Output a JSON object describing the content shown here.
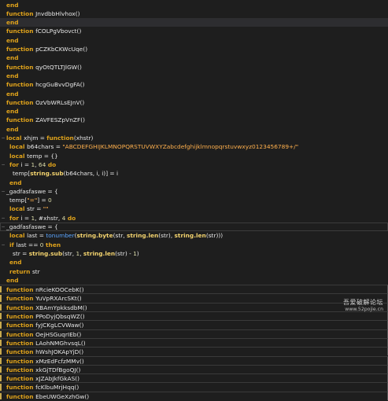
{
  "editor": {
    "lines": [
      {
        "tokens": [
          {
            "t": "end",
            "c": "kw"
          }
        ]
      },
      {
        "tokens": [
          {
            "t": "function ",
            "c": "kw"
          },
          {
            "t": "JnvdbbHlvhox()",
            "c": "id"
          }
        ]
      },
      {
        "tokens": [
          {
            "t": "end",
            "c": "kw"
          }
        ],
        "hl": true
      },
      {
        "tokens": [
          {
            "t": "function ",
            "c": "kw"
          },
          {
            "t": "fCOLPgVbovct()",
            "c": "id"
          }
        ]
      },
      {
        "tokens": [
          {
            "t": "end",
            "c": "kw"
          }
        ]
      },
      {
        "tokens": [
          {
            "t": "function ",
            "c": "kw"
          },
          {
            "t": "pCZKbCKWcUqe()",
            "c": "id"
          }
        ]
      },
      {
        "tokens": [
          {
            "t": "end",
            "c": "kw"
          }
        ]
      },
      {
        "tokens": [
          {
            "t": "function ",
            "c": "kw"
          },
          {
            "t": "qyOtQTLTJlGW()",
            "c": "id"
          }
        ]
      },
      {
        "tokens": [
          {
            "t": "end",
            "c": "kw"
          }
        ]
      },
      {
        "tokens": [
          {
            "t": "function ",
            "c": "kw"
          },
          {
            "t": "hcgGuBvvDgFA()",
            "c": "id"
          }
        ]
      },
      {
        "tokens": [
          {
            "t": "end",
            "c": "kw"
          }
        ]
      },
      {
        "tokens": [
          {
            "t": "function ",
            "c": "kw"
          },
          {
            "t": "OzVbWRLsEJnV()",
            "c": "id"
          }
        ]
      },
      {
        "tokens": [
          {
            "t": "end",
            "c": "kw"
          }
        ]
      },
      {
        "tokens": [
          {
            "t": "function ",
            "c": "kw"
          },
          {
            "t": "ZAVFESZpVnZF()",
            "c": "id"
          }
        ]
      },
      {
        "tokens": [
          {
            "t": "end",
            "c": "kw"
          }
        ]
      },
      {
        "tokens": [
          {
            "t": "local ",
            "c": "kw"
          },
          {
            "t": "xhjm = ",
            "c": "id"
          },
          {
            "t": "function",
            "c": "kw"
          },
          {
            "t": "(xhstr)",
            "c": "id"
          }
        ],
        "fold": "−"
      },
      {
        "tokens": [
          {
            "t": "local ",
            "c": "kw"
          },
          {
            "t": "b64chars = ",
            "c": "id"
          },
          {
            "t": "\"ABCDEFGHIJKLMNOPQRSTUVWXYZabcdefghijklmnopqrstuvwxyz0123456789+/\"",
            "c": "str"
          }
        ],
        "ind": 1
      },
      {
        "tokens": [
          {
            "t": "local ",
            "c": "kw"
          },
          {
            "t": "temp = {}",
            "c": "id"
          }
        ],
        "ind": 1
      },
      {
        "tokens": [
          {
            "t": "for ",
            "c": "kw"
          },
          {
            "t": "i = ",
            "c": "id"
          },
          {
            "t": "1",
            "c": "num"
          },
          {
            "t": ", ",
            "c": "id"
          },
          {
            "t": "64",
            "c": "num"
          },
          {
            "t": " do",
            "c": "kw"
          }
        ],
        "ind": 1,
        "fold": "−"
      },
      {
        "tokens": [
          {
            "t": "temp[",
            "c": "id"
          },
          {
            "t": "string.sub",
            "c": "bi"
          },
          {
            "t": "(b64chars, i, i)] = i",
            "c": "id"
          }
        ],
        "ind": 2
      },
      {
        "tokens": [
          {
            "t": "end",
            "c": "kw"
          }
        ],
        "ind": 1
      },
      {
        "tokens": [
          {
            "t": "_gadfasfaswe = {",
            "c": "id"
          }
        ],
        "fold": "−"
      },
      {
        "tokens": [
          {
            "t": "temp[",
            "c": "id"
          },
          {
            "t": "\"=\"",
            "c": "str"
          },
          {
            "t": "] = ",
            "c": "id"
          },
          {
            "t": "0",
            "c": "num"
          }
        ],
        "ind": 1
      },
      {
        "tokens": [
          {
            "t": "local ",
            "c": "kw"
          },
          {
            "t": "str = ",
            "c": "id"
          },
          {
            "t": "\"\"",
            "c": "str"
          }
        ],
        "ind": 1
      },
      {
        "tokens": [
          {
            "t": "for ",
            "c": "kw"
          },
          {
            "t": "i = ",
            "c": "id"
          },
          {
            "t": "1",
            "c": "num"
          },
          {
            "t": ", #xhstr, ",
            "c": "id"
          },
          {
            "t": "4",
            "c": "num"
          },
          {
            "t": " do",
            "c": "kw"
          }
        ],
        "ind": 1,
        "fold": "−"
      },
      {
        "tokens": [
          {
            "t": "_gadfasfaswe = {",
            "c": "id"
          }
        ],
        "fold": "−",
        "boxed": true
      },
      {
        "tokens": [
          {
            "t": "local ",
            "c": "kw"
          },
          {
            "t": "last = ",
            "c": "id"
          },
          {
            "t": "tonumber",
            "c": "fn-call"
          },
          {
            "t": "(",
            "c": "id"
          },
          {
            "t": "string.byte",
            "c": "bi"
          },
          {
            "t": "(str, ",
            "c": "id"
          },
          {
            "t": "string.len",
            "c": "bi"
          },
          {
            "t": "(str), ",
            "c": "id"
          },
          {
            "t": "string.len",
            "c": "bi"
          },
          {
            "t": "(str)))",
            "c": "id"
          }
        ],
        "ind": 1
      },
      {
        "tokens": [
          {
            "t": "if ",
            "c": "kw"
          },
          {
            "t": "last == ",
            "c": "id"
          },
          {
            "t": "0",
            "c": "num"
          },
          {
            "t": " then",
            "c": "kw"
          }
        ],
        "ind": 1,
        "fold": "−"
      },
      {
        "tokens": [
          {
            "t": "str = ",
            "c": "id"
          },
          {
            "t": "string.sub",
            "c": "bi"
          },
          {
            "t": "(str, ",
            "c": "id"
          },
          {
            "t": "1",
            "c": "num"
          },
          {
            "t": ", ",
            "c": "id"
          },
          {
            "t": "string.len",
            "c": "bi"
          },
          {
            "t": "(str) - ",
            "c": "id"
          },
          {
            "t": "1",
            "c": "num"
          },
          {
            "t": ")",
            "c": "id"
          }
        ],
        "ind": 2
      },
      {
        "tokens": [
          {
            "t": "end",
            "c": "kw"
          }
        ],
        "ind": 1
      },
      {
        "tokens": [
          {
            "t": "return ",
            "c": "kw"
          },
          {
            "t": "str",
            "c": "id"
          }
        ],
        "ind": 1
      },
      {
        "tokens": [
          {
            "t": "end",
            "c": "kw"
          }
        ]
      },
      {
        "tokens": [
          {
            "t": "function ",
            "c": "kw"
          },
          {
            "t": "nRcieKOOCebK()",
            "c": "id"
          }
        ],
        "sel": true
      },
      {
        "tokens": [
          {
            "t": "function ",
            "c": "kw"
          },
          {
            "t": "YuVpRXArcSKt()",
            "c": "id"
          }
        ],
        "sel": true
      },
      {
        "tokens": [
          {
            "t": "function ",
            "c": "kw"
          },
          {
            "t": "XBAmYpkksdbM()",
            "c": "id"
          }
        ],
        "sel": true
      },
      {
        "tokens": [
          {
            "t": "function ",
            "c": "kw"
          },
          {
            "t": "PPoDyjQbsqWZ()",
            "c": "id"
          }
        ],
        "sel": true
      },
      {
        "tokens": [
          {
            "t": "function ",
            "c": "kw"
          },
          {
            "t": "fyJCKgLCVWaw()",
            "c": "id"
          }
        ],
        "sel": true
      },
      {
        "tokens": [
          {
            "t": "function ",
            "c": "kw"
          },
          {
            "t": "OejHSGuqrIEb()",
            "c": "id"
          }
        ],
        "sel": true
      },
      {
        "tokens": [
          {
            "t": "function ",
            "c": "kw"
          },
          {
            "t": "LAohNMGhvsqL()",
            "c": "id"
          }
        ],
        "sel": true
      },
      {
        "tokens": [
          {
            "t": "function ",
            "c": "kw"
          },
          {
            "t": "hWshJOKApYjD()",
            "c": "id"
          }
        ],
        "sel": true
      },
      {
        "tokens": [
          {
            "t": "function ",
            "c": "kw"
          },
          {
            "t": "xMzEdFcfzMMv()",
            "c": "id"
          }
        ],
        "sel": true
      },
      {
        "tokens": [
          {
            "t": "function ",
            "c": "kw"
          },
          {
            "t": "xkGjTDfBgoQJ()",
            "c": "id"
          }
        ],
        "sel": true
      },
      {
        "tokens": [
          {
            "t": "function ",
            "c": "kw"
          },
          {
            "t": "xJZAbJkfGkAS()",
            "c": "id"
          }
        ],
        "sel": true
      },
      {
        "tokens": [
          {
            "t": "function ",
            "c": "kw"
          },
          {
            "t": "fcKlbuMrjHqq()",
            "c": "id"
          }
        ],
        "sel": true
      },
      {
        "tokens": [
          {
            "t": "function ",
            "c": "kw"
          },
          {
            "t": "EbeUWGeXzhGw()",
            "c": "id"
          }
        ],
        "sel": true
      }
    ]
  },
  "watermark": {
    "title": "吾爱破解论坛",
    "url": "www.52pojie.cn"
  },
  "colors": {
    "background": "#1e1e1e",
    "keyword": "#e0a31b",
    "string": "#ffb04d",
    "builtin": "#f3d36e",
    "call": "#5ba5ff"
  }
}
